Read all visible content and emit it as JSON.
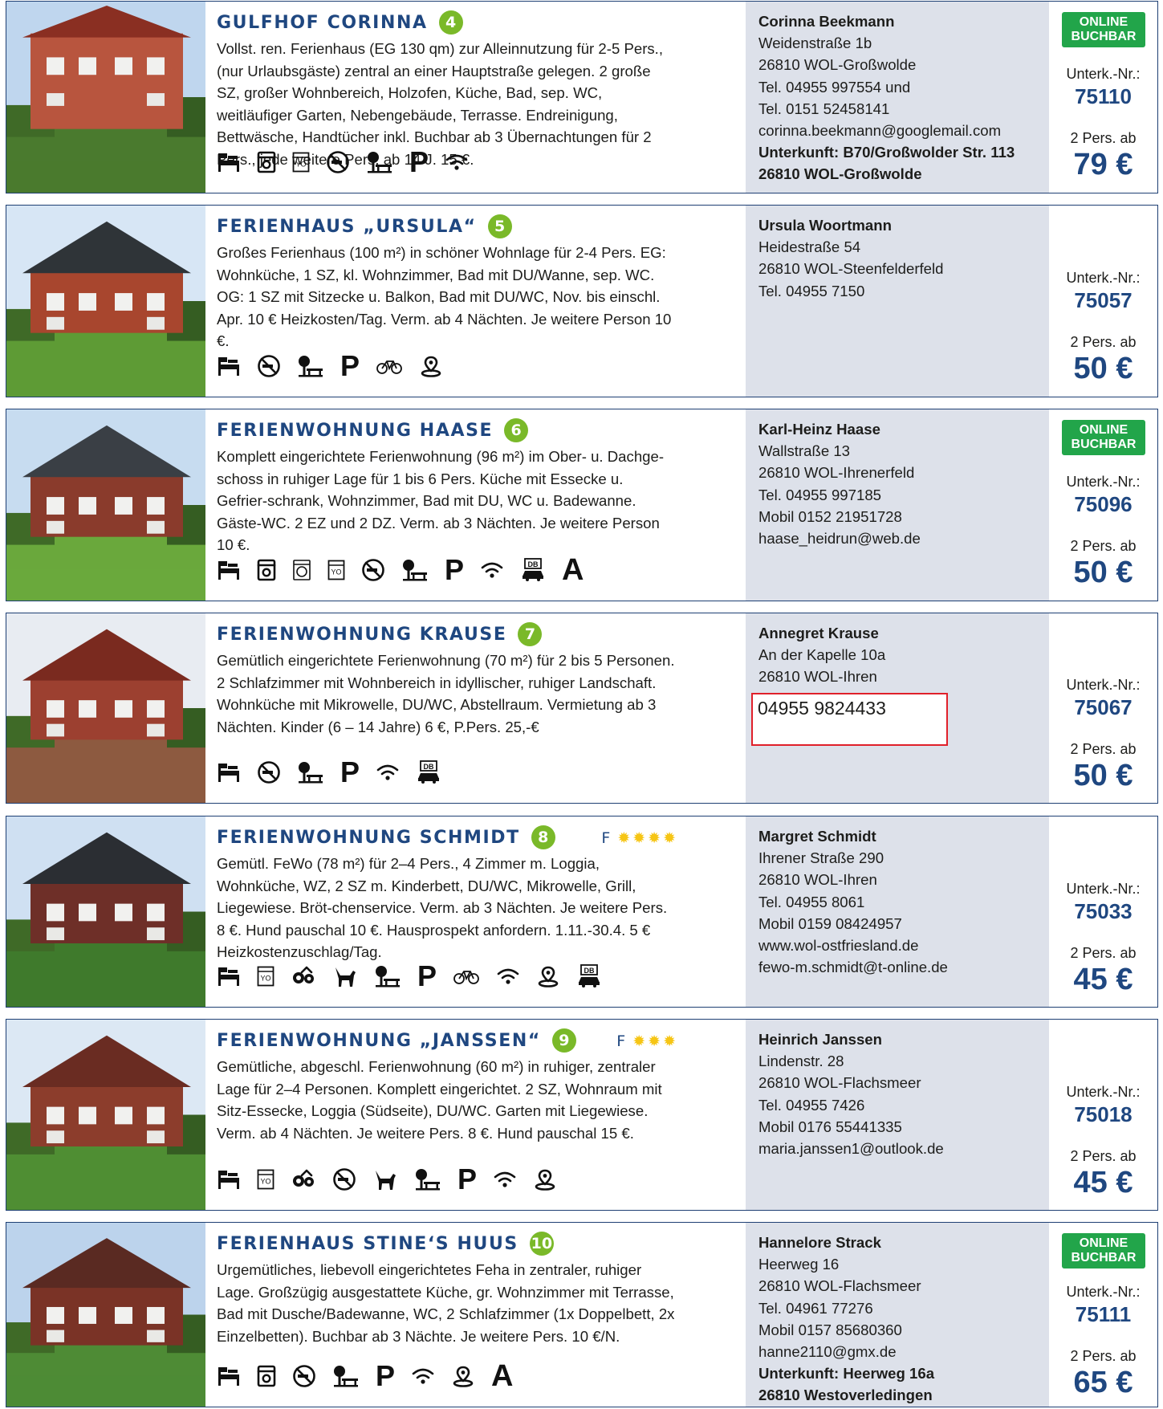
{
  "listings": [
    {
      "title": "GULFHOF CORINNA",
      "number": "4",
      "description": "Vollst. ren. Ferienhaus (EG 130 qm) zur Alleinnutzung für 2-5 Pers., (nur Urlaubsgäste) zentral an einer Hauptstraße gelegen. 2 große SZ, großer Wohnbereich, Holzofen, Küche, Bad, sep. WC, weitläufiger Garten, Nebengebäude, Terrasse. Endreinigung, Bettwäsche, Handtücher inkl. Buchbar ab 3 Übernachtungen für 2 Pers., jede weitere Pers. ab 14 J. 15 €.",
      "icons": [
        "bed-icon",
        "washing-machine-icon",
        "dryer-icon",
        "no-smoking-icon",
        "garden-bench-icon",
        "parking-icon",
        "wifi-icon"
      ],
      "contact": {
        "name": "Corinna Beekmann",
        "lines": [
          "Weidenstraße 1b",
          "26810 WOL-Großwolde",
          "Tel. 04955 997554 und",
          "Tel. 0151 52458141",
          "corinna.beekmann@googlemail.com"
        ],
        "bold_lines": [
          "Unterkunft: B70/Großwolder Str. 113",
          "26810 WOL-Großwolde"
        ]
      },
      "online": "ONLINE BUCHBAR",
      "unterk_label": "Unterk.-Nr.:",
      "unterk_nr": "75110",
      "pers": "2 Pers. ab",
      "price": "79 €"
    },
    {
      "title": "FERIENHAUS „URSULA“",
      "number": "5",
      "description": "Großes Ferienhaus (100 m²) in schöner Wohnlage für 2-4 Pers. EG: Wohnküche, 1 SZ, kl. Wohnzimmer, Bad mit DU/Wanne, sep. WC. OG: 1 SZ mit Sitzecke u. Balkon, Bad mit DU/WC, Nov. bis einschl. Apr. 10 € Heizkosten/Tag. Verm. ab 4 Nächten. Je weitere Person 10 €.",
      "icons": [
        "bed-icon",
        "no-smoking-icon",
        "garden-bench-icon",
        "parking-icon",
        "bicycle-icon",
        "location-pin-icon"
      ],
      "contact": {
        "name": "Ursula Woortmann",
        "lines": [
          "Heidestraße 54",
          "26810 WOL-Steenfelderfeld",
          "Tel. 04955 7150"
        ],
        "bold_lines": []
      },
      "online": "",
      "unterk_label": "Unterk.-Nr.:",
      "unterk_nr": "75057",
      "pers": "2 Pers. ab",
      "price": "50 €"
    },
    {
      "title": "FERIENWOHNUNG HAASE",
      "number": "6",
      "description": "Komplett eingerichtete Ferienwohnung (96 m²) im Ober- u. Dachge-schoss in ruhiger Lage für 1 bis 6 Pers. Küche mit Essecke u. Gefrier-schrank, Wohnzimmer, Bad mit DU, WC u. Badewanne. Gäste-WC. 2 EZ und 2 DZ. Verm. ab 3 Nächten. Je weitere Person 10 €.",
      "icons": [
        "bed-icon",
        "washing-machine-icon",
        "front-loader-icon",
        "dryer-icon",
        "no-smoking-icon",
        "garden-bench-icon",
        "parking-icon",
        "wifi-icon",
        "train-station-icon",
        "a-icon"
      ],
      "contact": {
        "name": "Karl-Heinz Haase",
        "lines": [
          "Wallstraße 13",
          "26810 WOL-Ihrenerfeld",
          "Tel. 04955 997185",
          "Mobil 0152 21951728",
          "haase_heidrun@web.de"
        ],
        "bold_lines": []
      },
      "online": "ONLINE BUCHBAR",
      "unterk_label": "Unterk.-Nr.:",
      "unterk_nr": "75096",
      "pers": "2 Pers. ab",
      "price": "50 €"
    },
    {
      "title": "FERIENWOHNUNG KRAUSE",
      "number": "7",
      "description": "Gemütlich eingerichtete Ferienwohnung (70 m²) für 2 bis 5 Personen. 2 Schlafzimmer mit Wohnbereich in idyllischer, ruhiger Landschaft. Wohnküche mit Mikrowelle, DU/WC, Abstellraum. Vermietung ab 3 Nächten. Kinder (6 – 14 Jahre) 6 €, P.Pers. 25,-€",
      "icons": [
        "bed-icon",
        "no-smoking-icon",
        "garden-bench-icon",
        "parking-icon",
        "wifi-icon",
        "train-station-icon"
      ],
      "contact": {
        "name": "Annegret Krause",
        "lines": [
          "An der Kapelle 10a",
          "26810 WOL-Ihren"
        ],
        "bold_lines": [],
        "phone_box": "04955 9824433"
      },
      "online": "",
      "unterk_label": "Unterk.-Nr.:",
      "unterk_nr": "75067",
      "pers": "2 Pers. ab",
      "price": "50 €"
    },
    {
      "title": "FERIENWOHNUNG SCHMIDT",
      "number": "8",
      "rating_letter": "F",
      "stars": 4,
      "description": "Gemütl. FeWo (78 m²) für 2–4 Pers., 4 Zimmer m. Loggia, Wohnküche, WZ, 2 SZ m. Kinderbett, DU/WC, Mikrowelle, Grill, Liegewiese. Bröt-chenservice. Verm. ab 3 Nächten. Je weitere Pers. 8 €. Hund pauschal 10 €. Hausprospekt anfordern. 1.11.-30.4. 5 € Heizkostenzuschlag/Tag.",
      "icons": [
        "bed-icon",
        "dryer-icon",
        "family-icon",
        "dog-icon",
        "garden-bench-icon",
        "parking-icon",
        "bicycle-icon",
        "wifi-icon",
        "location-pin-icon",
        "train-station-icon"
      ],
      "contact": {
        "name": "Margret Schmidt",
        "lines": [
          "Ihrener Straße 290",
          "26810 WOL-Ihren",
          "Tel. 04955 8061",
          "Mobil 0159 08424957",
          "www.wol-ostfriesland.de",
          "fewo-m.schmidt@t-online.de"
        ],
        "bold_lines": []
      },
      "online": "",
      "unterk_label": "Unterk.-Nr.:",
      "unterk_nr": "75033",
      "pers": "2 Pers. ab",
      "price": "45 €"
    },
    {
      "title": "FERIENWOHNUNG „JANSSEN“",
      "number": "9",
      "rating_letter": "F",
      "stars": 3,
      "description": "Gemütliche, abgeschl. Ferienwohnung (60 m²) in ruhiger, zentraler Lage für 2–4 Personen. Komplett eingerichtet. 2 SZ, Wohnraum mit Sitz-Essecke, Loggia (Südseite), DU/WC. Garten mit Liegewiese. Verm. ab 4 Nächten. Je weitere Pers. 8 €. Hund pauschal 15 €.",
      "icons": [
        "bed-icon",
        "dryer-icon",
        "family-icon",
        "no-smoking-icon",
        "dog-icon",
        "garden-bench-icon",
        "parking-icon",
        "wifi-icon",
        "location-pin-icon"
      ],
      "contact": {
        "name": "Heinrich Janssen",
        "lines": [
          "Lindenstr. 28",
          "26810 WOL-Flachsmeer",
          "Tel. 04955 7426",
          "Mobil 0176 55441335",
          "maria.janssen1@outlook.de"
        ],
        "bold_lines": []
      },
      "online": "",
      "unterk_label": "Unterk.-Nr.:",
      "unterk_nr": "75018",
      "pers": "2 Pers. ab",
      "price": "45 €"
    },
    {
      "title": "FERIENHAUS STINE‘S HUUS",
      "number": "10",
      "description": "Urgemütliches, liebevoll eingerichtetes Feha in zentraler, ruhiger Lage. Großzügig ausgestattete Küche, gr. Wohnzimmer mit Terrasse, Bad mit Dusche/Badewanne, WC, 2 Schlafzimmer (1x Doppelbett, 2x Einzelbetten). Buchbar ab 3 Nächte. Je weitere Pers. 10 €/N.",
      "icons": [
        "bed-icon",
        "washing-machine-icon",
        "no-smoking-icon",
        "garden-bench-icon",
        "parking-icon",
        "wifi-icon",
        "location-pin-icon",
        "a-icon"
      ],
      "contact": {
        "name": "Hannelore Strack",
        "lines": [
          "Heerweg 16",
          "26810 WOL-Flachsmeer",
          "Tel. 04961 77276",
          "Mobil 0157 85680360",
          "hanne2110@gmx.de"
        ],
        "bold_lines": [
          "Unterkunft: Heerweg 16a",
          "26810 Westoverledingen"
        ]
      },
      "online": "ONLINE BUCHBAR",
      "unterk_label": "Unterk.-Nr.:",
      "unterk_nr": "75111",
      "pers": "2 Pers. ab",
      "price": "65 €"
    }
  ],
  "icon_glyphs": {
    "parking-icon": "P",
    "a-icon": "A",
    "train-station-icon": "DB"
  },
  "colors": {
    "title": "#1f4780",
    "badge": "#7ab929",
    "online": "#22a54a",
    "contact_bg": "#dde1ea",
    "border": "#1e3f73",
    "star": "#f6c514"
  }
}
